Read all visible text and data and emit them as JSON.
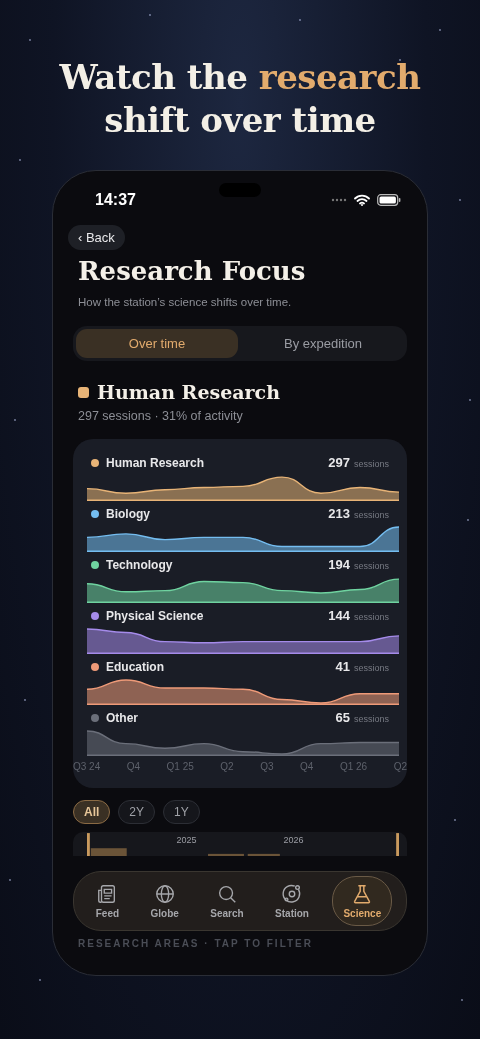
{
  "headline": {
    "text": "Watch the ",
    "accent": "research",
    "rest": "shift over time"
  },
  "status_bar": {
    "time": "14:37"
  },
  "back_button": {
    "chevron": "‹",
    "label": "Back"
  },
  "title": "Research Focus",
  "subtitle": "How the station’s science shifts over time.",
  "view_toggle": [
    {
      "label": "Over time",
      "selected": true
    },
    {
      "label": "By expedition",
      "selected": false
    }
  ],
  "focus": {
    "name": "Human Research",
    "color": "#e8b477",
    "summary": "297 sessions · 31% of activity"
  },
  "series": [
    {
      "name": "Human Research",
      "color": "#e8b477",
      "count": "297",
      "unit": "sessions"
    },
    {
      "name": "Biology",
      "color": "#74bdf0",
      "count": "213",
      "unit": "sessions"
    },
    {
      "name": "Technology",
      "color": "#6fd3a0",
      "count": "194",
      "unit": "sessions"
    },
    {
      "name": "Physical Science",
      "color": "#a58bea",
      "count": "144",
      "unit": "sessions"
    },
    {
      "name": "Education",
      "color": "#ee9a78",
      "count": "41",
      "unit": "sessions"
    },
    {
      "name": "Other",
      "color": "#6b6f7a",
      "count": "65",
      "unit": "sessions"
    }
  ],
  "axis_labels": [
    "Q3 24",
    "Q4",
    "Q1 25",
    "Q2",
    "Q3",
    "Q4",
    "Q1 26",
    "Q2"
  ],
  "range_chips": [
    {
      "label": "All",
      "selected": true
    },
    {
      "label": "2Y",
      "selected": false
    },
    {
      "label": "1Y",
      "selected": false
    }
  ],
  "timeline": {
    "years": [
      "2025",
      "2026"
    ]
  },
  "tab_bar": [
    {
      "kind": "feed",
      "label": "Feed",
      "selected": false
    },
    {
      "kind": "globe",
      "label": "Globe",
      "selected": false
    },
    {
      "kind": "search",
      "label": "Search",
      "selected": false
    },
    {
      "kind": "station",
      "label": "Station",
      "selected": false
    },
    {
      "kind": "science",
      "label": "Science",
      "selected": true
    }
  ],
  "section_label": "RESEARCH AREAS · TAP TO FILTER"
}
